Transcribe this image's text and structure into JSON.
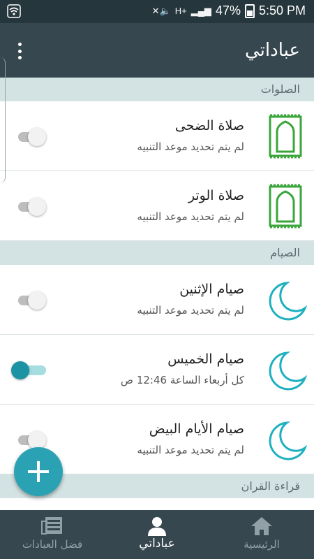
{
  "status_bar": {
    "battery_percent": "47%",
    "time": "5:50 PM",
    "network_label": "H+"
  },
  "app_bar": {
    "title": "عباداتي"
  },
  "sections": [
    {
      "header": "الصلوات",
      "items": [
        {
          "title": "صلاة الضحى",
          "subtitle": "لم يتم تحديد موعد التنبيه",
          "icon": "prayer-mat-icon",
          "enabled": false
        },
        {
          "title": "صلاة الوتر",
          "subtitle": "لم يتم تحديد موعد التنبيه",
          "icon": "prayer-mat-icon",
          "enabled": false
        }
      ]
    },
    {
      "header": "الصيام",
      "items": [
        {
          "title": "صيام الإثنين",
          "subtitle": "لم يتم تحديد موعد التنبيه",
          "icon": "crescent-moon-icon",
          "enabled": false
        },
        {
          "title": "صيام الخميس",
          "subtitle": "كل أربعاء الساعة 12:46 ص",
          "icon": "crescent-moon-icon",
          "enabled": true
        },
        {
          "title": "صيام الأيام البيض",
          "subtitle": "لم يتم تحديد موعد التنبيه",
          "icon": "crescent-moon-icon",
          "enabled": false
        }
      ]
    },
    {
      "header": "قراءة القران",
      "items": []
    }
  ],
  "bottom_nav": [
    {
      "label": "فضل العبادات",
      "icon": "newspaper-icon",
      "active": false
    },
    {
      "label": "عباداتي",
      "icon": "person-icon",
      "active": true
    },
    {
      "label": "الرئيسية",
      "icon": "home-icon",
      "active": false
    }
  ],
  "colors": {
    "app_bar": "#37474f",
    "status_bar": "#26363d",
    "section_header_bg": "#d3e3e3",
    "accent": "#2aa2b3",
    "prayer_icon": "#3aa53a"
  }
}
